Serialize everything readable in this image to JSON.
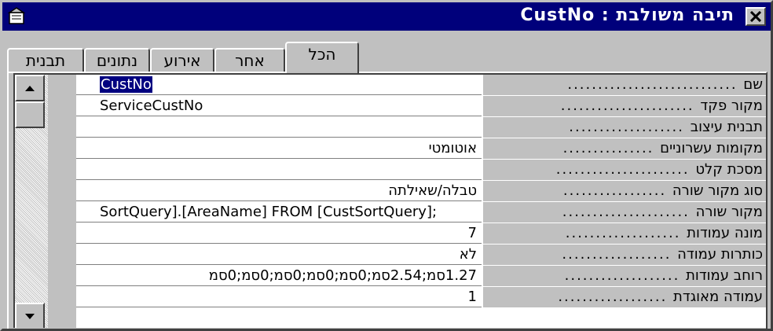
{
  "window": {
    "title": "תיבה משולבת : CustNo"
  },
  "tabs": [
    {
      "label": "הכל",
      "active": true
    },
    {
      "label": "אחר",
      "active": false
    },
    {
      "label": "אירוע",
      "active": false
    },
    {
      "label": "נתונים",
      "active": false
    },
    {
      "label": "תבנית",
      "active": false
    }
  ],
  "properties": [
    {
      "label": "שם",
      "value": "CustNo",
      "selected": true
    },
    {
      "label": "מקור פקד",
      "value": "ServiceCustNo"
    },
    {
      "label": "תבנית עיצוב",
      "value": ""
    },
    {
      "label": "מקומות עשרוניים",
      "value": "אוטומטי"
    },
    {
      "label": "מסכת קלט",
      "value": ""
    },
    {
      "label": "סוג מקור שורה",
      "value": "טבלה/שאילתה"
    },
    {
      "label": "מקור שורה",
      "value": "SortQuery].[AreaName] FROM [CustSortQuery];"
    },
    {
      "label": "מונה עמודות",
      "value": "7"
    },
    {
      "label": "כותרות עמודה",
      "value": "לא"
    },
    {
      "label": "רוחב עמודות",
      "value": "1.27סמ;2.54סמ;0סמ;0סמ;0סמ;0סמ;0סמ"
    },
    {
      "label": "עמודה מאוגדת",
      "value": "1"
    }
  ],
  "colors": {
    "titlebar": "#00007b",
    "face": "#c0c0c0",
    "selection": "#000080"
  }
}
